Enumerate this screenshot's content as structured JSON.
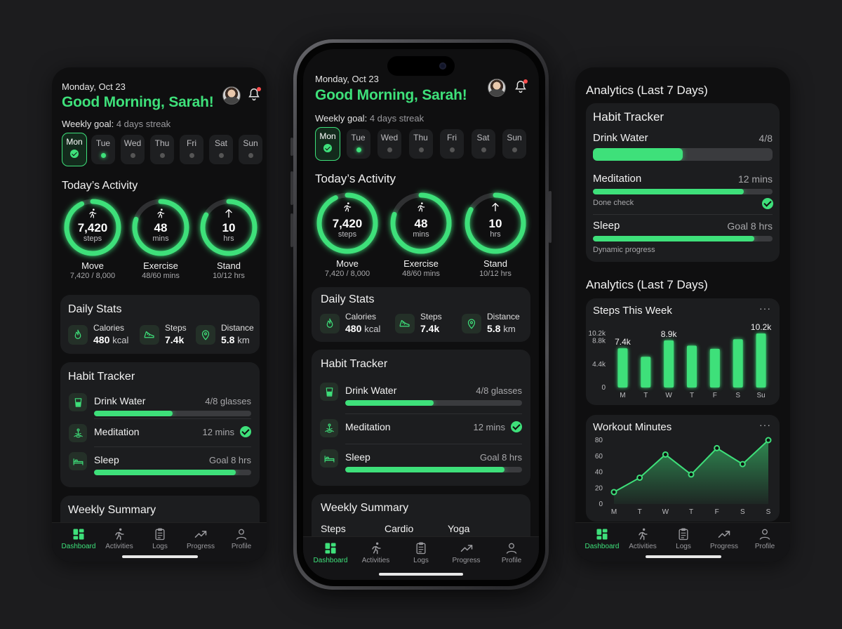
{
  "header": {
    "date": "Monday, Oct 23",
    "greeting": "Good Morning, Sarah!",
    "goal_label": "Weekly goal:",
    "goal_value": "4 days streak"
  },
  "days": [
    {
      "label": "Mon",
      "state": "done"
    },
    {
      "label": "Tue",
      "state": "partial"
    },
    {
      "label": "Wed",
      "state": "none"
    },
    {
      "label": "Thu",
      "state": "none"
    },
    {
      "label": "Fri",
      "state": "none"
    },
    {
      "label": "Sat",
      "state": "none"
    },
    {
      "label": "Sun",
      "state": "none"
    }
  ],
  "activity": {
    "title": "Today’s Activity",
    "rings": [
      {
        "value": "7,420",
        "unit": "steps",
        "name": "Move",
        "sub": "7,420 / 8,000",
        "progress": 0.93,
        "icon": "running-icon"
      },
      {
        "value": "48",
        "unit": "mins",
        "name": "Exercise",
        "sub": "48/60 mins",
        "progress": 0.8,
        "icon": "running-icon"
      },
      {
        "value": "10",
        "unit": "hrs",
        "name": "Stand",
        "sub": "10/12 hrs",
        "progress": 0.83,
        "icon": "arrow-up-icon"
      }
    ]
  },
  "daily_stats": {
    "title": "Daily Stats",
    "items": [
      {
        "label": "Calories",
        "value": "480",
        "unit": "kcal",
        "icon": "flame-icon"
      },
      {
        "label": "Steps",
        "value": "7.4k",
        "unit": "",
        "icon": "shoe-icon"
      },
      {
        "label": "Distance",
        "value": "5.8",
        "unit": "km",
        "icon": "location-pin-icon"
      }
    ]
  },
  "habits": {
    "title": "Habit Tracker",
    "items": [
      {
        "name": "Drink Water",
        "right": "4/8 glasses",
        "progress": 0.5,
        "icon": "water-glass-icon"
      },
      {
        "name": "Meditation",
        "right": "12 mins",
        "progress": 1.0,
        "icon": "meditation-icon",
        "done": true
      },
      {
        "name": "Sleep",
        "right": "Goal 8 hrs",
        "progress": 0.9,
        "icon": "bed-icon"
      }
    ]
  },
  "weekly_summary": {
    "title": "Weekly Summary",
    "columns": [
      "Steps",
      "Cardio",
      "Yoga"
    ]
  },
  "tabs": [
    {
      "label": "Dashboard",
      "icon": "dashboard-icon",
      "active": true
    },
    {
      "label": "Activities",
      "icon": "running-icon",
      "active": false
    },
    {
      "label": "Logs",
      "icon": "clipboard-icon",
      "active": false
    },
    {
      "label": "Progress",
      "icon": "trend-icon",
      "active": false
    },
    {
      "label": "Profile",
      "icon": "person-icon",
      "active": false
    }
  ],
  "analytics": {
    "title1": "Analytics (Last 7 Days)",
    "habit_card": {
      "title": "Habit Tracker",
      "items": [
        {
          "name": "Drink Water",
          "right": "4/8",
          "progress": 0.5
        },
        {
          "name": "Meditation",
          "right": "12 mins",
          "progress": 0.84,
          "note": "Done check"
        },
        {
          "name": "Sleep",
          "right": "Goal 8 hrs",
          "progress": 0.9,
          "note": "Dynamic progress"
        }
      ]
    },
    "title2": "Analytics (Last 7 Days)",
    "more_label": "···"
  },
  "chart_data": [
    {
      "type": "bar",
      "title": "Steps This Week",
      "categories": [
        "M",
        "T",
        "W",
        "T",
        "F",
        "S",
        "Su"
      ],
      "values": [
        7.4,
        5.8,
        8.9,
        7.9,
        7.3,
        9.1,
        10.2
      ],
      "value_unit": "k",
      "data_labels": {
        "0": "7.4k",
        "2": "8.9k",
        "6": "10.2k"
      },
      "yticks": [
        "0",
        "4.4k",
        "8.8k",
        "10.2k"
      ],
      "ytick_values": [
        0,
        4.4,
        8.8,
        10.2
      ],
      "ylim": [
        0,
        10.2
      ],
      "color": "#3ee07a"
    },
    {
      "type": "area",
      "title": "Workout Minutes",
      "categories": [
        "M",
        "T",
        "W",
        "T",
        "F",
        "S",
        "S"
      ],
      "values": [
        15,
        33,
        62,
        37,
        70,
        50,
        80
      ],
      "yticks": [
        0,
        20,
        40,
        60,
        80
      ],
      "ylim": [
        0,
        80
      ],
      "color": "#3ee07a"
    }
  ],
  "colors": {
    "accent": "#3ee07a",
    "background": "#0f0f10",
    "card": "#1c1d1f",
    "notification": "#ff4d4d"
  }
}
